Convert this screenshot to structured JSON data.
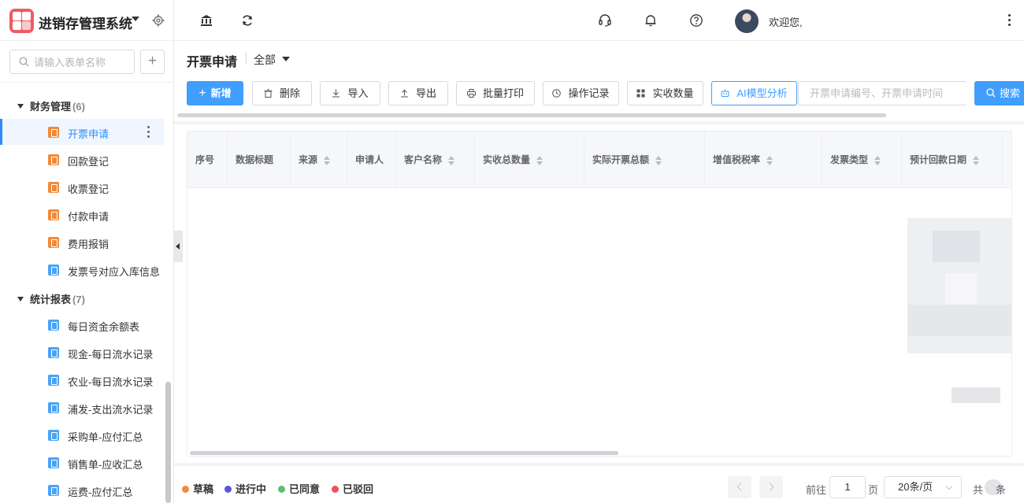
{
  "app": {
    "title": "进销存管理系统",
    "search_placeholder": "请输入表单名称",
    "add_label": "+"
  },
  "sidebar": {
    "groups": [
      {
        "label": "财务管理",
        "count": "(6)",
        "items": [
          {
            "label": "开票申请",
            "icon": "orange",
            "active": true
          },
          {
            "label": "回款登记",
            "icon": "orange"
          },
          {
            "label": "收票登记",
            "icon": "orange"
          },
          {
            "label": "付款申请",
            "icon": "orange"
          },
          {
            "label": "费用报销",
            "icon": "orange"
          },
          {
            "label": "发票号对应入库信息",
            "icon": "blue"
          }
        ]
      },
      {
        "label": "统计报表",
        "count": "(7)",
        "items": [
          {
            "label": "每日资金余额表",
            "icon": "blue"
          },
          {
            "label": "现金-每日流水记录",
            "icon": "blue"
          },
          {
            "label": "农业-每日流水记录",
            "icon": "blue"
          },
          {
            "label": "浦发-支出流水记录",
            "icon": "blue"
          },
          {
            "label": "采购单-应付汇总",
            "icon": "blue"
          },
          {
            "label": "销售单-应收汇总",
            "icon": "blue"
          },
          {
            "label": "运费-应付汇总",
            "icon": "blue"
          }
        ]
      }
    ]
  },
  "header": {
    "welcome": "欢迎您,",
    "icons": [
      "bank-icon",
      "refresh-icon",
      "headset-icon",
      "bell-icon",
      "help-icon"
    ]
  },
  "page": {
    "title": "开票申请",
    "filter": "全部"
  },
  "toolbar": {
    "new": "新增",
    "delete": "删除",
    "import": "导入",
    "export": "导出",
    "batch_print": "批量打印",
    "op_log": "操作记录",
    "received_qty": "实收数量",
    "ai": "AI模型分析",
    "query_placeholder": "开票申请编号、开票申请时间",
    "search": "搜索",
    "primary_color": "#409eff"
  },
  "table": {
    "columns": [
      {
        "label": "序号",
        "sortable": false
      },
      {
        "label": "数据标题",
        "sortable": false
      },
      {
        "label": "来源",
        "sortable": true
      },
      {
        "label": "申请人",
        "sortable": false
      },
      {
        "label": "客户名称",
        "sortable": true
      },
      {
        "label": "实收总数量",
        "sortable": true
      },
      {
        "label": "实际开票总额",
        "sortable": true
      },
      {
        "label": "增值税税率",
        "sortable": true
      },
      {
        "label": "发票类型",
        "sortable": true
      },
      {
        "label": "预计回款日期",
        "sortable": true
      }
    ]
  },
  "legend": [
    {
      "label": "草稿",
      "color": "#f5893a"
    },
    {
      "label": "进行中",
      "color": "#5a55d8"
    },
    {
      "label": "已同意",
      "color": "#5cc06b"
    },
    {
      "label": "已驳回",
      "color": "#f0505a"
    }
  ],
  "pagination": {
    "goto_label": "前往",
    "page": "1",
    "page_suffix": "页",
    "page_size": "20条/页",
    "total_prefix": "共",
    "total_suffix": "条"
  }
}
